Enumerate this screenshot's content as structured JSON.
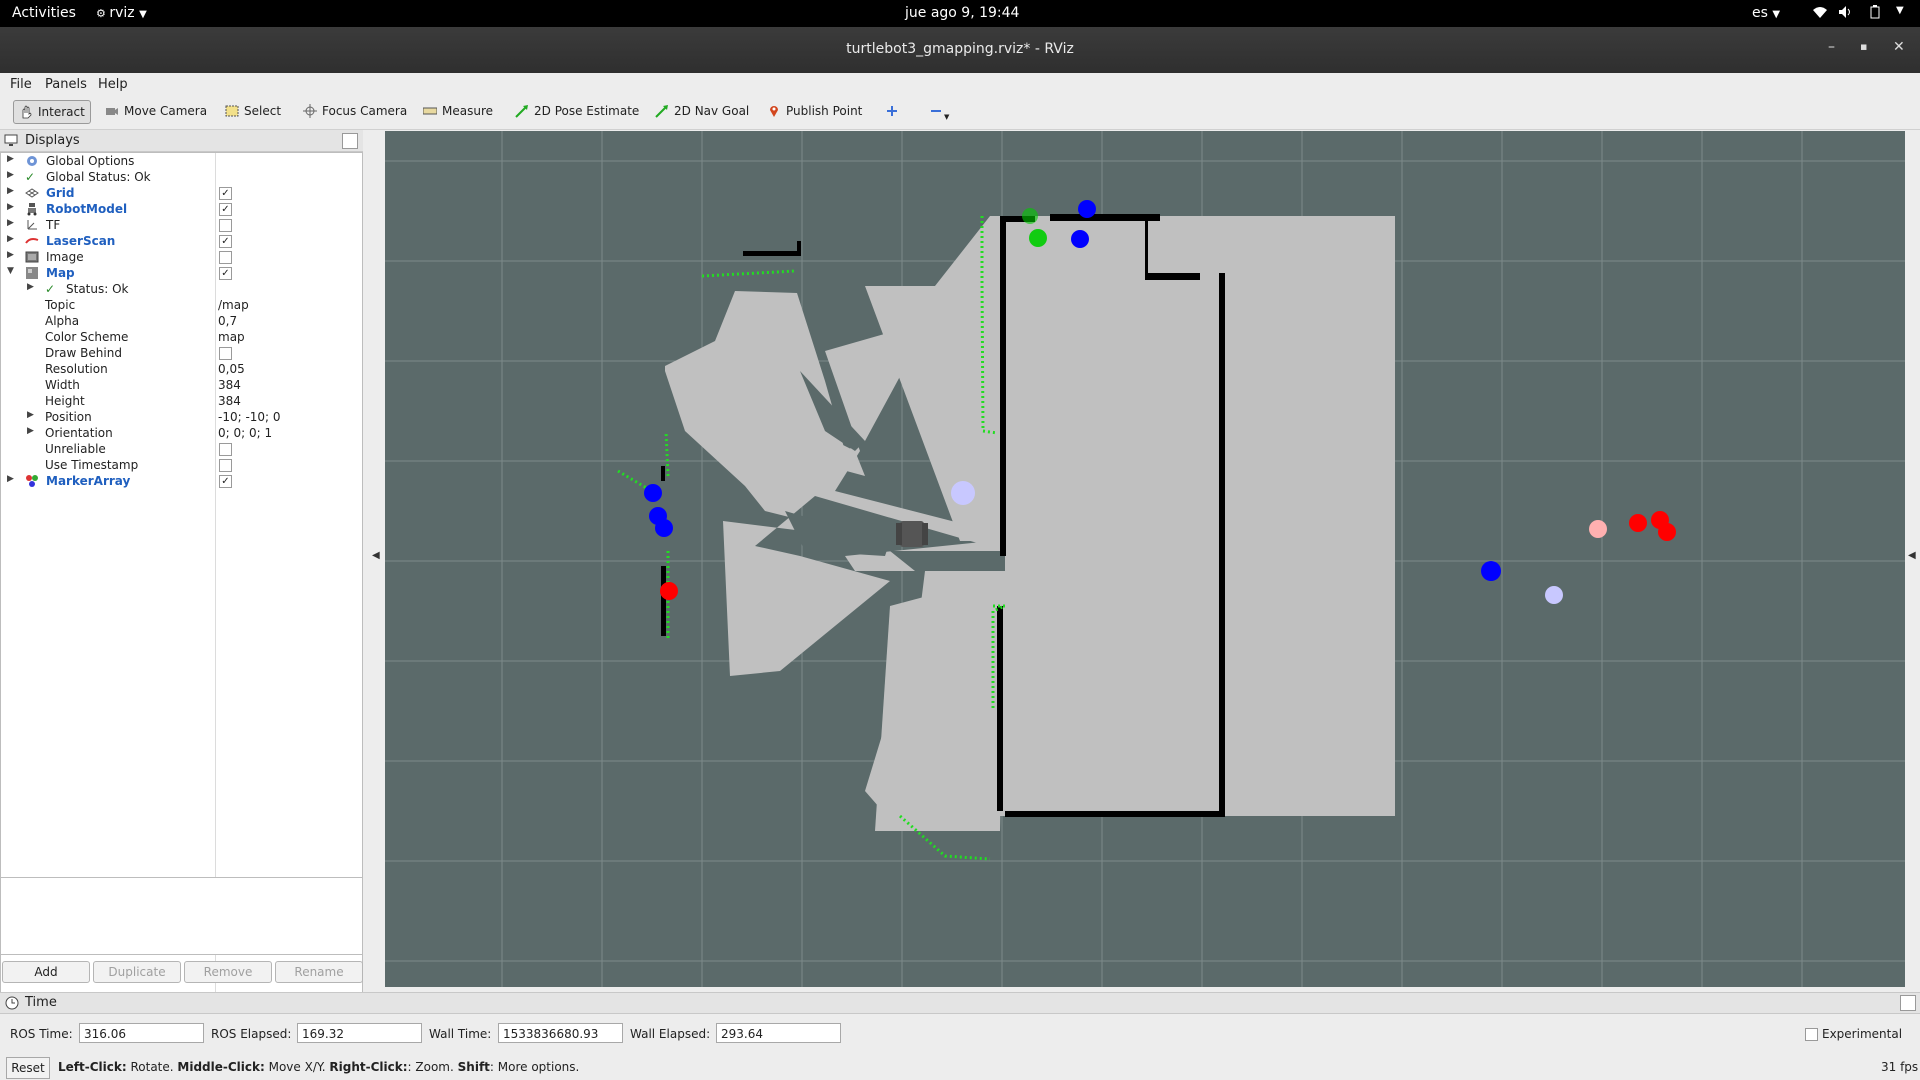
{
  "topbar": {
    "activities": "Activities",
    "app": "rviz",
    "clock": "jue ago  9, 19:44",
    "lang": "es"
  },
  "window": {
    "title": "turtlebot3_gmapping.rviz* - RViz"
  },
  "menu": {
    "file": "File",
    "panels": "Panels",
    "help": "Help"
  },
  "toolbar": {
    "interact": "Interact",
    "move_camera": "Move Camera",
    "select": "Select",
    "focus_camera": "Focus Camera",
    "measure": "Measure",
    "pose_estimate": "2D Pose Estimate",
    "nav_goal": "2D Nav Goal",
    "publish_point": "Publish Point"
  },
  "displays": {
    "title": "Displays",
    "global_options": "Global Options",
    "global_status": "Global Status: Ok",
    "grid": "Grid",
    "robot_model": "RobotModel",
    "tf": "TF",
    "laser_scan": "LaserScan",
    "image": "Image",
    "map": "Map",
    "map_status": "Status: Ok",
    "props": {
      "topic": {
        "label": "Topic",
        "value": "/map"
      },
      "alpha": {
        "label": "Alpha",
        "value": "0,7"
      },
      "color_scheme": {
        "label": "Color Scheme",
        "value": "map"
      },
      "draw_behind": {
        "label": "Draw Behind"
      },
      "resolution": {
        "label": "Resolution",
        "value": "0,05"
      },
      "width": {
        "label": "Width",
        "value": "384"
      },
      "height": {
        "label": "Height",
        "value": "384"
      },
      "position": {
        "label": "Position",
        "value": "-10; -10; 0"
      },
      "orientation": {
        "label": "Orientation",
        "value": "0; 0; 0; 1"
      },
      "unreliable": {
        "label": "Unreliable"
      },
      "use_timestamp": {
        "label": "Use Timestamp"
      }
    },
    "marker_array": "MarkerArray",
    "buttons": {
      "add": "Add",
      "duplicate": "Duplicate",
      "remove": "Remove",
      "rename": "Rename"
    }
  },
  "time": {
    "title": "Time",
    "ros_time_label": "ROS Time:",
    "ros_time": "316.06",
    "ros_elapsed_label": "ROS Elapsed:",
    "ros_elapsed": "169.32",
    "wall_time_label": "Wall Time:",
    "wall_time": "1533836680.93",
    "wall_elapsed_label": "Wall Elapsed:",
    "wall_elapsed": "293.64",
    "experimental": "Experimental"
  },
  "status": {
    "reset": "Reset",
    "help_left_bold": "Left-Click:",
    "help_left": " Rotate. ",
    "help_mid_bold": "Middle-Click:",
    "help_mid": " Move X/Y. ",
    "help_right_bold": "Right-Click:",
    "help_right": ": Zoom. ",
    "help_shift_bold": "Shift",
    "help_shift": ": More options.",
    "fps": "31 fps"
  },
  "colors": {
    "viewport_bg": "#5b6a6a",
    "free_space": "#c0c0c0",
    "wall": "#000000",
    "laser": "#22dd22",
    "marker_blue": "#0000ff",
    "marker_red": "#ff0000"
  }
}
